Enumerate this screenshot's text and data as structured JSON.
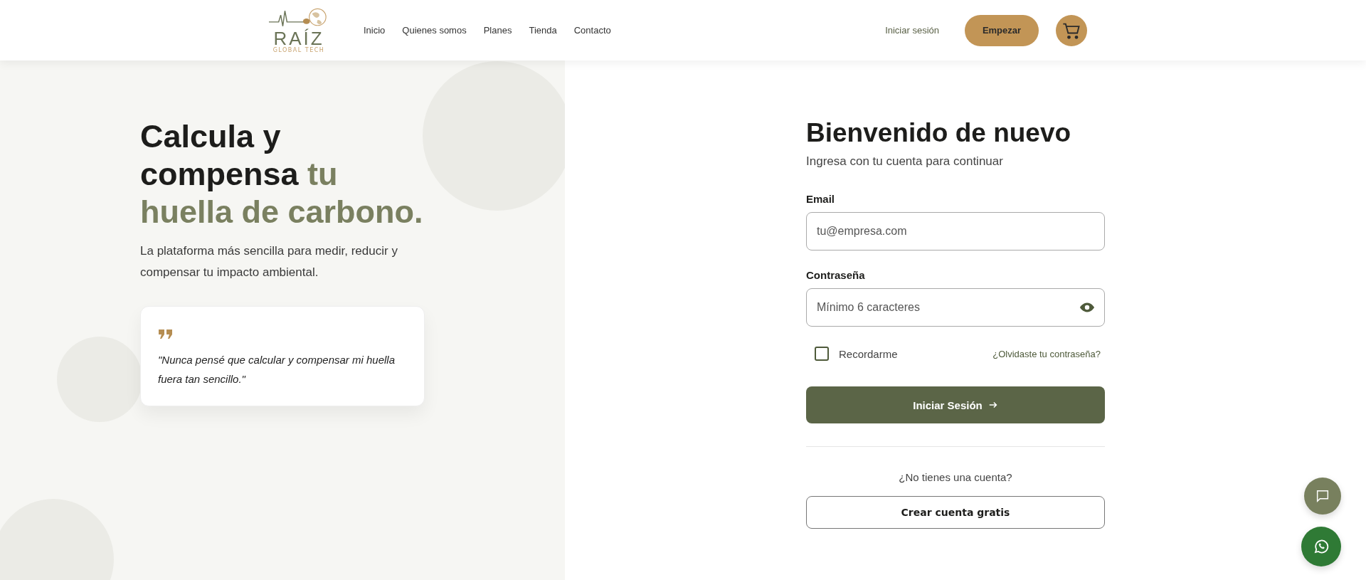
{
  "header": {
    "logo": {
      "name": "RAÍZ",
      "tagline": "GLOBAL TECH"
    },
    "nav": [
      "Inicio",
      "Quienes somos",
      "Planes",
      "Tienda",
      "Contacto"
    ],
    "login_link": "Iniciar sesión",
    "cta": "Empezar"
  },
  "hero": {
    "title": "Calcula y compensa **tu huella de carbono.**",
    "subtitle": "La plataforma más sencilla para medir, reducir y compensar tu impacto ambiental.",
    "quote": "\"Nunca pensé que calcular y compensar mi huella fuera tan sencillo.\""
  },
  "form": {
    "title": "Bienvenido de nuevo",
    "subtitle": "Ingresa con tu cuenta para continuar",
    "email": {
      "label": "Email",
      "placeholder": "tu@empresa.com"
    },
    "password": {
      "label": "Contraseña",
      "placeholder": "Mínimo 6 caracteres"
    },
    "remember": {
      "label": "Recordarme",
      "checked": false
    },
    "forgot": "¿Olvidaste tu contraseña?",
    "submit": "Iniciar Sesión",
    "signup_prompt": "¿No tienes una cuenta?",
    "signup": "Crear cuenta gratis"
  }
}
